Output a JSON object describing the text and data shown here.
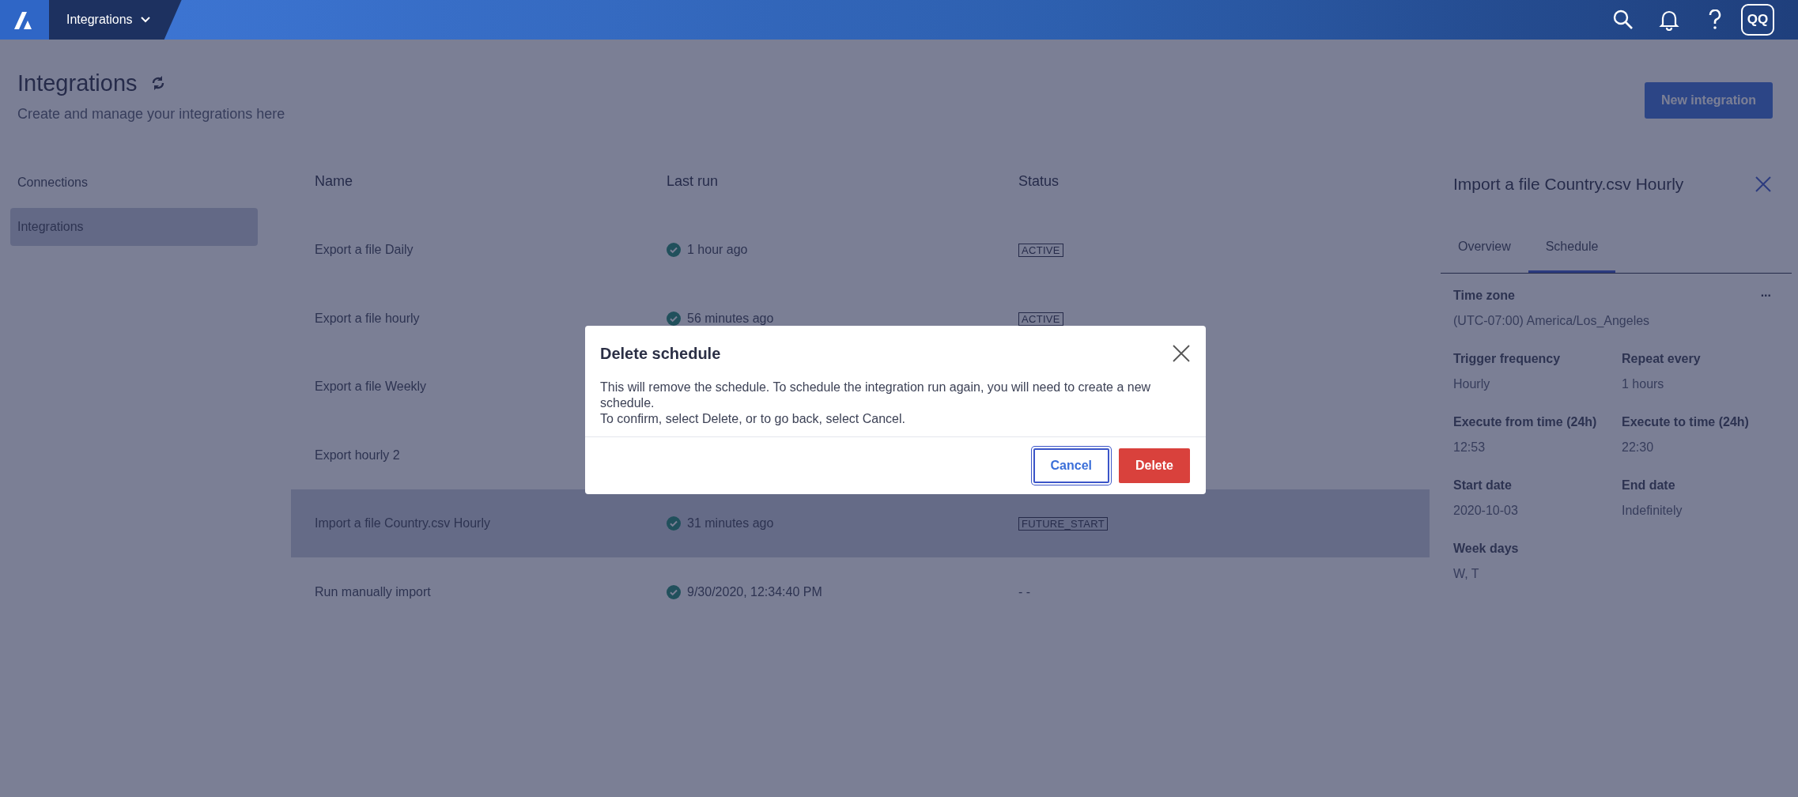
{
  "topbar": {
    "menu": "Integrations",
    "avatar": "QQ"
  },
  "page": {
    "title": "Integrations",
    "subtitle": "Create and manage your integrations here",
    "new_button": "New integration"
  },
  "sidebar": {
    "items": [
      {
        "label": "Connections",
        "selected": false
      },
      {
        "label": "Integrations",
        "selected": true
      }
    ]
  },
  "table": {
    "columns": [
      "Name",
      "Last run",
      "Status"
    ],
    "rows": [
      {
        "name": "Export a file Daily",
        "last_run": "1 hour ago",
        "status": {
          "text": "ACTIVE",
          "kind": "badge"
        },
        "selected": false
      },
      {
        "name": "Export a file hourly",
        "last_run": "56 minutes ago",
        "status": {
          "text": "ACTIVE",
          "kind": "badge"
        },
        "selected": false
      },
      {
        "name": "Export a file Weekly",
        "selected": false
      },
      {
        "name": "Export hourly 2",
        "selected": false
      },
      {
        "name": "Import a file Country.csv Hourly",
        "last_run": "31 minutes ago",
        "status": {
          "text": "FUTURE_START",
          "kind": "badge"
        },
        "selected": true
      },
      {
        "name": "Run manually import",
        "last_run": "9/30/2020, 12:34:40 PM",
        "status": {
          "text": "- -",
          "kind": "plain"
        },
        "selected": false
      }
    ]
  },
  "detail": {
    "title": "Import a file Country.csv Hourly",
    "tabs": [
      {
        "label": "Overview",
        "selected": false
      },
      {
        "label": "Schedule",
        "selected": true
      }
    ],
    "more": "...",
    "rows": [
      [
        {
          "label": "Time zone",
          "value": "(UTC-07:00) America/Los_Angeles"
        }
      ],
      [
        {
          "label": "Trigger frequency",
          "value": "Hourly"
        },
        {
          "label": "Repeat every",
          "value": "1 hours"
        }
      ],
      [
        {
          "label": "Execute from time (24h)",
          "value": "12:53"
        },
        {
          "label": "Execute to time (24h)",
          "value": "22:30"
        }
      ],
      [
        {
          "label": "Start date",
          "value": "2020-10-03"
        },
        {
          "label": "End date",
          "value": "Indefinitely"
        }
      ],
      [
        {
          "label": "Week days",
          "value": "W, T"
        }
      ]
    ]
  },
  "dialog": {
    "title": "Delete schedule",
    "paragraphs": [
      "This will remove the schedule. To schedule the integration run again, you will need to create a new schedule.",
      "To confirm, select Delete, or to go back, select Cancel."
    ],
    "buttons": [
      {
        "label": "Cancel",
        "kind": "secondary"
      },
      {
        "label": "Delete",
        "kind": "danger"
      }
    ]
  }
}
